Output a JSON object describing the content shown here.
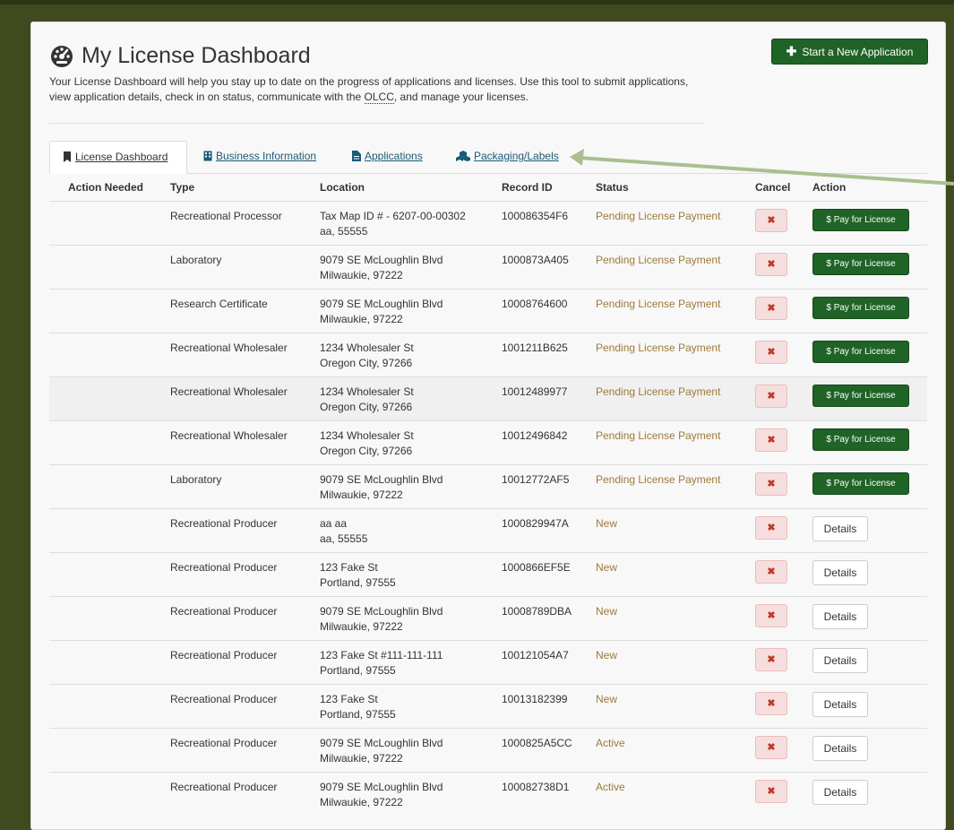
{
  "header": {
    "title": "My License Dashboard",
    "intro_part1": "Your License Dashboard will help you stay up to date on the progress of applications and licenses. Use this tool to submit applications, view application details, check in on status, communicate with the ",
    "intro_abbr": "OLCC",
    "intro_part2": ", and manage your licenses.",
    "new_app_label": "Start a New Application"
  },
  "tabs": [
    {
      "label": "License Dashboard",
      "icon": "bookmark-icon"
    },
    {
      "label": "Business Information",
      "icon": "building-icon"
    },
    {
      "label": "Applications",
      "icon": "file-icon"
    },
    {
      "label": "Packaging/Labels",
      "icon": "cubes-icon"
    }
  ],
  "table": {
    "headers": {
      "action_needed": "Action Needed",
      "type": "Type",
      "location": "Location",
      "record_id": "Record ID",
      "status": "Status",
      "cancel": "Cancel",
      "action": "Action"
    },
    "cancel_glyph": "✖",
    "pay_label": "$ Pay for License",
    "details_label": "Details",
    "rows": [
      {
        "type": "Recreational Processor",
        "loc1": "Tax Map ID # - 6207-00-00302",
        "loc2": "aa, 55555",
        "record_id": "100086354F6",
        "status": "Pending License Payment",
        "action": "pay"
      },
      {
        "type": "Laboratory",
        "loc1": "9079 SE McLoughlin Blvd",
        "loc2": "Milwaukie, 97222",
        "record_id": "1000873A405",
        "status": "Pending License Payment",
        "action": "pay"
      },
      {
        "type": "Research Certificate",
        "loc1": "9079 SE McLoughlin Blvd",
        "loc2": "Milwaukie, 97222",
        "record_id": "10008764600",
        "status": "Pending License Payment",
        "action": "pay"
      },
      {
        "type": "Recreational Wholesaler",
        "loc1": "1234 Wholesaler St",
        "loc2": "Oregon City, 97266",
        "record_id": "1001211B625",
        "status": "Pending License Payment",
        "action": "pay"
      },
      {
        "type": "Recreational Wholesaler",
        "loc1": "1234 Wholesaler St",
        "loc2": "Oregon City, 97266",
        "record_id": "10012489977",
        "status": "Pending License Payment",
        "action": "pay"
      },
      {
        "type": "Recreational Wholesaler",
        "loc1": "1234 Wholesaler St",
        "loc2": "Oregon City, 97266",
        "record_id": "10012496842",
        "status": "Pending License Payment",
        "action": "pay"
      },
      {
        "type": "Laboratory",
        "loc1": "9079 SE McLoughlin Blvd",
        "loc2": "Milwaukie, 97222",
        "record_id": "10012772AF5",
        "status": "Pending License Payment",
        "action": "pay"
      },
      {
        "type": "Recreational Producer",
        "loc1": "aa aa",
        "loc2": "aa, 55555",
        "record_id": "1000829947A",
        "status": "New",
        "action": "details"
      },
      {
        "type": "Recreational Producer",
        "loc1": "123 Fake St",
        "loc2": "Portland, 97555",
        "record_id": "1000866EF5E",
        "status": "New",
        "action": "details"
      },
      {
        "type": "Recreational Producer",
        "loc1": "9079 SE McLoughlin Blvd",
        "loc2": "Milwaukie, 97222",
        "record_id": "10008789DBA",
        "status": "New",
        "action": "details"
      },
      {
        "type": "Recreational Producer",
        "loc1": "123 Fake St #111-111-111",
        "loc2": "Portland, 97555",
        "record_id": "100121054A7",
        "status": "New",
        "action": "details"
      },
      {
        "type": "Recreational Producer",
        "loc1": "123 Fake St",
        "loc2": "Portland, 97555",
        "record_id": "10013182399",
        "status": "New",
        "action": "details"
      },
      {
        "type": "Recreational Producer",
        "loc1": "9079 SE McLoughlin Blvd",
        "loc2": "Milwaukie, 97222",
        "record_id": "1000825A5CC",
        "status": "Active",
        "action": "details"
      },
      {
        "type": "Recreational Producer",
        "loc1": "9079 SE McLoughlin Blvd",
        "loc2": "Milwaukie, 97222",
        "record_id": "100082738D1",
        "status": "Active",
        "action": "details"
      }
    ]
  },
  "colors": {
    "brand_green": "#1f6326",
    "status_text": "#9c7a3c",
    "annotation_arrow": "#a9bf8f"
  }
}
